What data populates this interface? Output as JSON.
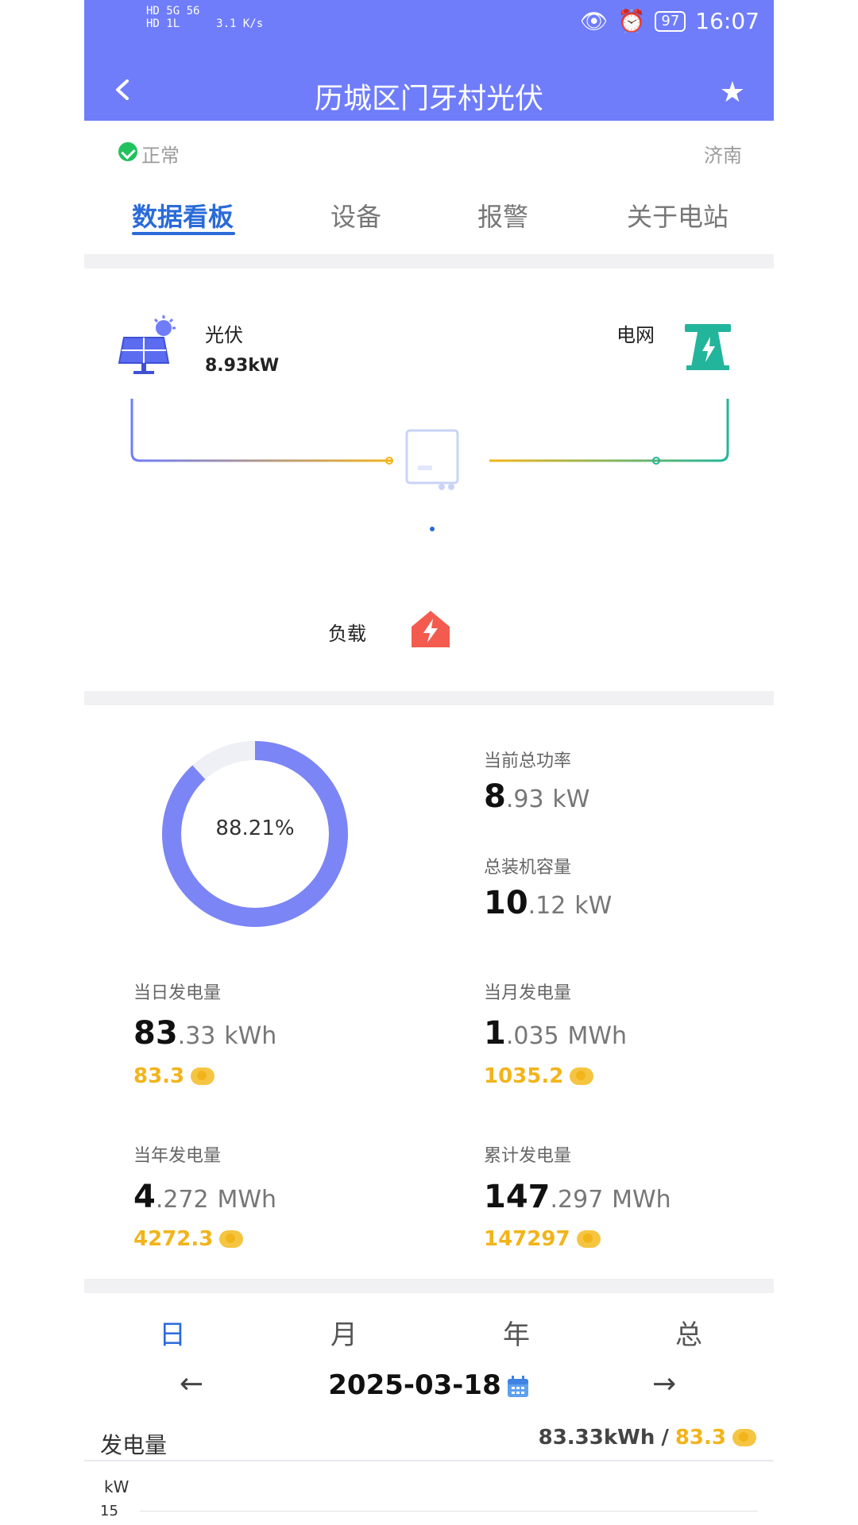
{
  "status_bar": {
    "left_line1": "HD 5G 56",
    "left_line2": "HD 1L",
    "net_speed": "3.1 K/s",
    "battery": "97",
    "time": "16:07"
  },
  "header": {
    "title": "历城区门牙村光伏"
  },
  "station": {
    "status": "正常",
    "city": "济南"
  },
  "tabs": [
    "数据看板",
    "设备",
    "报警",
    "关于电站"
  ],
  "flow": {
    "pv_label": "光伏",
    "pv_value": "8.93kW",
    "grid_label": "电网",
    "load_label": "负载"
  },
  "stats": {
    "ratio_percent": 88.21,
    "ratio_label": "88.21%",
    "current_power_label": "当前总功率",
    "current_power_int": "8",
    "current_power_dec": ".93",
    "current_power_unit": "kW",
    "capacity_label": "总装机容量",
    "capacity_int": "10",
    "capacity_dec": ".12",
    "capacity_unit": "kW",
    "day_label": "当日发电量",
    "day_int": "83",
    "day_dec": ".33",
    "day_unit": "kWh",
    "day_coin": "83.3",
    "month_label": "当月发电量",
    "month_int": "1",
    "month_dec": ".035",
    "month_unit": "MWh",
    "month_coin": "1035.2",
    "year_label": "当年发电量",
    "year_int": "4",
    "year_dec": ".272",
    "year_unit": "MWh",
    "year_coin": "4272.3",
    "total_label": "累计发电量",
    "total_int": "147",
    "total_dec": ".297",
    "total_unit": "MWh",
    "total_coin": "147297"
  },
  "period_tabs": [
    "日",
    "月",
    "年",
    "总"
  ],
  "date": "2025-03-18",
  "generation": {
    "label": "发电量",
    "value": "83.33kWh",
    "separator": "/",
    "coin": "83.3"
  },
  "chart_axis": {
    "unit": "kW",
    "tick": "15"
  },
  "colors": {
    "header": "#6f7dfb",
    "accent_blue": "#2b6bd8",
    "ring": "#7b85f5",
    "coin_yellow": "#f2b41b",
    "grid_teal": "#23b59b",
    "load_red": "#f35b4f"
  }
}
